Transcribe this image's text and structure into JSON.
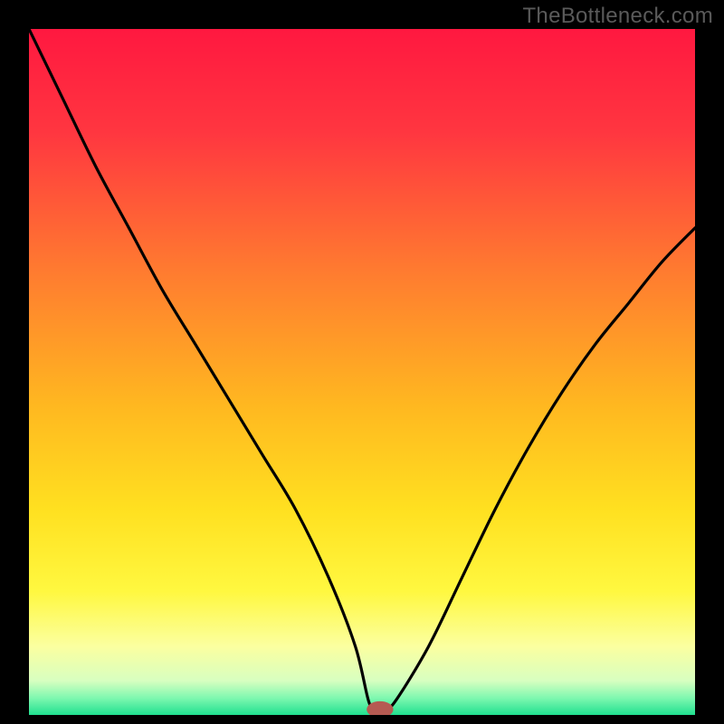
{
  "watermark": "TheBottleneck.com",
  "chart_data": {
    "type": "line",
    "title": "",
    "xlabel": "",
    "ylabel": "",
    "xlim": [
      0,
      100
    ],
    "ylim": [
      0,
      100
    ],
    "grid": false,
    "legend": false,
    "annotations": [],
    "series": [
      {
        "name": "curve",
        "x": [
          0,
          5,
          10,
          15,
          20,
          25,
          30,
          35,
          40,
          45,
          49,
          51,
          52,
          53.5,
          55,
          60,
          65,
          70,
          75,
          80,
          85,
          90,
          95,
          100
        ],
        "values": [
          100,
          90,
          80,
          71,
          62,
          54,
          46,
          38,
          30,
          20,
          10,
          2,
          1,
          1,
          2,
          10,
          20,
          30,
          39,
          47,
          54,
          60,
          66,
          71
        ]
      }
    ],
    "marker": {
      "x": 52.7,
      "y": 0.8,
      "rx": 2.0,
      "ry": 1.2
    },
    "background_gradient": {
      "stops": [
        {
          "offset": 0.0,
          "color": "#ff1840"
        },
        {
          "offset": 0.15,
          "color": "#ff3640"
        },
        {
          "offset": 0.35,
          "color": "#ff7a30"
        },
        {
          "offset": 0.55,
          "color": "#ffb820"
        },
        {
          "offset": 0.7,
          "color": "#ffe020"
        },
        {
          "offset": 0.82,
          "color": "#fff840"
        },
        {
          "offset": 0.9,
          "color": "#fbffa0"
        },
        {
          "offset": 0.95,
          "color": "#d8ffc0"
        },
        {
          "offset": 0.975,
          "color": "#80f8b0"
        },
        {
          "offset": 1.0,
          "color": "#20e090"
        }
      ]
    }
  }
}
